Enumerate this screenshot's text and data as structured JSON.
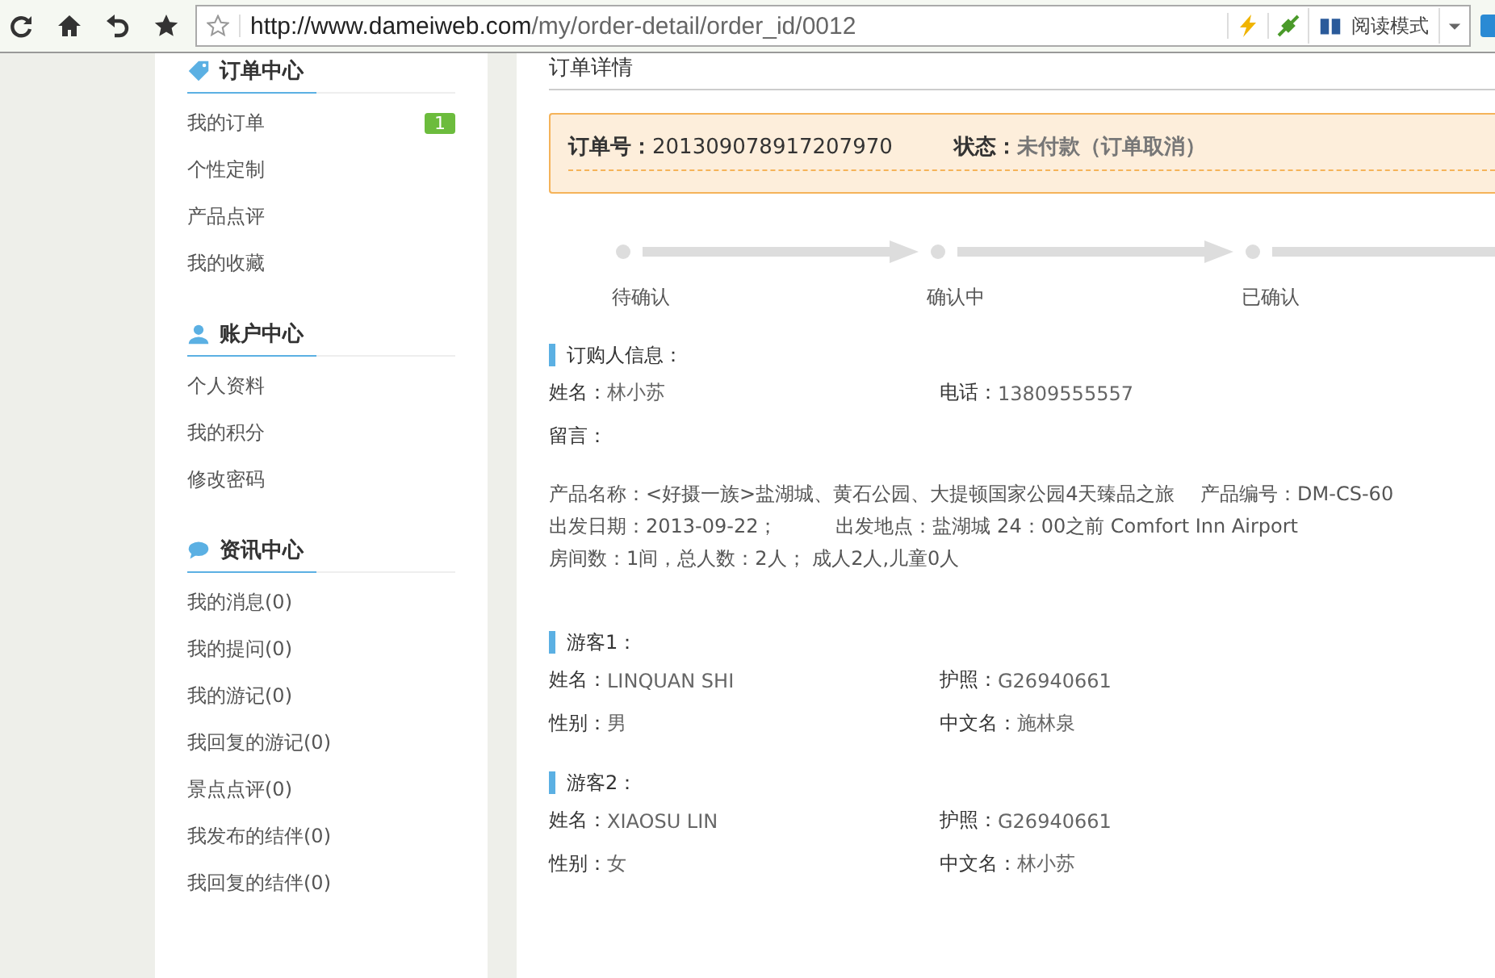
{
  "browser": {
    "url_host": "http://www.dameiweb.com",
    "url_path": "/my/order-detail/order_id/0012",
    "reader_mode": "阅读模式"
  },
  "sidebar": {
    "sections": [
      {
        "title": "订单中心",
        "items": [
          {
            "label": "我的订单",
            "badge": "1"
          },
          {
            "label": "个性定制"
          },
          {
            "label": "产品点评"
          },
          {
            "label": "我的收藏"
          }
        ]
      },
      {
        "title": "账户中心",
        "items": [
          {
            "label": "个人资料"
          },
          {
            "label": "我的积分"
          },
          {
            "label": "修改密码"
          }
        ]
      },
      {
        "title": "资讯中心",
        "items": [
          {
            "label": "我的消息(0)"
          },
          {
            "label": "我的提问(0)"
          },
          {
            "label": "我的游记(0)"
          },
          {
            "label": "我回复的游记(0)"
          },
          {
            "label": "景点点评(0)"
          },
          {
            "label": "我发布的结伴(0)"
          },
          {
            "label": "我回复的结伴(0)"
          }
        ]
      }
    ]
  },
  "page_title": "订单详情",
  "order": {
    "number_label": "订单号：",
    "number": "201309078917207970",
    "status_label": "状态：",
    "status": "未付款（订单取消）"
  },
  "steps": [
    "待确认",
    "确认中",
    "已确认"
  ],
  "buyer": {
    "title": "订购人信息：",
    "fields": [
      {
        "label": "姓名：",
        "value": "林小苏"
      },
      {
        "label": "电话：",
        "value": "13809555557"
      },
      {
        "label": "留言："
      }
    ]
  },
  "product_lines": [
    "产品名称：<好摄一族>盐湖城、黄石公园、大提顿国家公园4天臻品之旅　 产品编号：DM-CS-60",
    "出发日期：2013-09-22；　　　出发地点：盐湖城  24：00之前  Comfort Inn Airport",
    "房间数：1间，总人数：2人；  成人2人,儿童0人"
  ],
  "guests": [
    {
      "title": "游客1：",
      "fields": [
        {
          "label": "姓名：",
          "value": "LINQUAN SHI"
        },
        {
          "label": "护照：",
          "value": "G26940661"
        },
        {
          "label": "性别：",
          "value": "男"
        },
        {
          "label": "中文名：",
          "value": "施林泉"
        }
      ]
    },
    {
      "title": "游客2：",
      "fields": [
        {
          "label": "姓名：",
          "value": "XIAOSU LIN"
        },
        {
          "label": "护照：",
          "value": "G26940661"
        },
        {
          "label": "性别：",
          "value": "女"
        },
        {
          "label": "中文名：",
          "value": "林小苏"
        }
      ]
    }
  ]
}
